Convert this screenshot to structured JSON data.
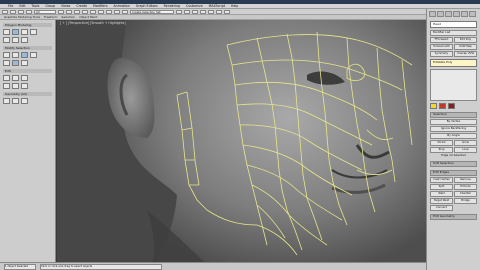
{
  "menu": {
    "items": [
      "File",
      "Edit",
      "Tools",
      "Group",
      "Views",
      "Create",
      "Modifiers",
      "Animation",
      "Graph Editors",
      "Rendering",
      "Customize",
      "MAXScript",
      "Help"
    ]
  },
  "toolbar": {
    "selection_filter": "All",
    "named_set": "Create Selection Set"
  },
  "ribbon": {
    "tabs": [
      "Graphite Modeling Tools",
      "Freeform",
      "Selection",
      "Object Paint"
    ]
  },
  "viewport": {
    "label": "[ + ] [Perspective] [Smooth + Highlights]"
  },
  "left_panel": {
    "sections": [
      "Polygon Modeling",
      "Modify Selection",
      "Edit",
      "Geometry (All)"
    ]
  },
  "right_panel": {
    "object_name": "Head",
    "modifier_list": "Modifier List",
    "buttons": [
      "FFD Select",
      "Edit Poly",
      "Turbosmooth",
      "UVW Map",
      "Symmetry",
      "Unwrap UVW"
    ],
    "stack_item": "Editable Poly",
    "rollouts": [
      "Selection",
      "Soft Selection",
      "Edit Edges",
      "Edit Geometry"
    ],
    "selection_options": [
      "By Vertex",
      "Ignore Backfacing",
      "By Angle",
      "Shrink",
      "Grow",
      "Ring",
      "Loop"
    ],
    "selected_status": "Edge 12 Selected",
    "edit_buttons": [
      "Insert Vertex",
      "Remove",
      "Split",
      "Extrude",
      "Weld",
      "Chamfer",
      "Target Weld",
      "Bridge",
      "Connect"
    ],
    "colors": {
      "swatch1": "#f2d72e",
      "swatch2": "#c0392b",
      "swatch3": "#8a1d1d"
    }
  },
  "status": {
    "selected": "1 Object Selected",
    "prompt": "Click or click-and-drag to select objects"
  },
  "colors": {
    "wire": "#e9e58a",
    "bg": "#474747"
  }
}
